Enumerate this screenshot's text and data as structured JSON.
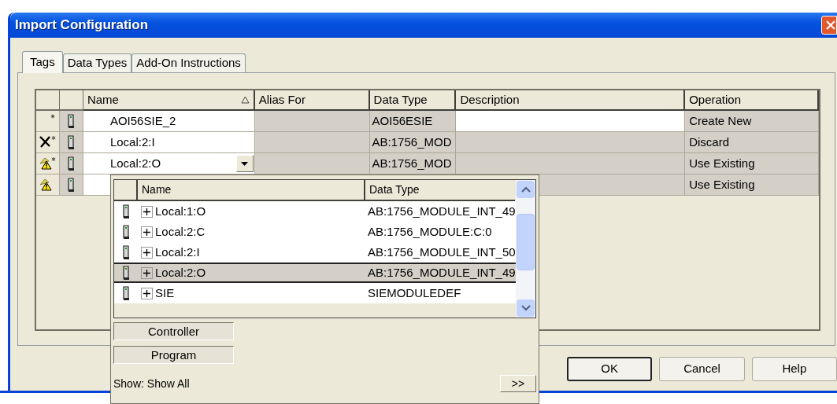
{
  "window": {
    "title": "Import Configuration"
  },
  "tabs": [
    {
      "label": "Tags",
      "selected": true
    },
    {
      "label": "Data Types",
      "selected": false
    },
    {
      "label": "Add-On Instructions",
      "selected": false
    }
  ],
  "grid": {
    "columns": [
      {
        "label": "Name",
        "sorted": true
      },
      {
        "label": "Alias For",
        "sorted": false
      },
      {
        "label": "Data Type",
        "sorted": false
      },
      {
        "label": "Description",
        "sorted": false
      },
      {
        "label": "Operation",
        "sorted": false
      }
    ],
    "rows": [
      {
        "kind": "new",
        "modified": true,
        "name": "AOI56SIE_2",
        "data_type": "AOI56ESIE",
        "description_editable": true,
        "editing": false,
        "operation": "Create New"
      },
      {
        "kind": "discard",
        "modified": true,
        "name": "Local:2:I",
        "data_type": "AB:1756_MOD",
        "description_editable": false,
        "editing": false,
        "operation": "Discard"
      },
      {
        "kind": "conflict",
        "modified": true,
        "name": "Local:2:O",
        "data_type": "AB:1756_MOD",
        "description_editable": false,
        "editing": true,
        "operation": "Use Existing"
      },
      {
        "kind": "conflict",
        "modified": false,
        "description_editable": false,
        "editing": false,
        "operation": "Use Existing"
      }
    ]
  },
  "tag_picker": {
    "columns": [
      "Name",
      "Data Type"
    ],
    "rows": [
      {
        "name": "Local:1:O",
        "data_type": "AB:1756_MODULE_INT_49",
        "selected": false
      },
      {
        "name": "Local:2:C",
        "data_type": "AB:1756_MODULE:C:0",
        "selected": false
      },
      {
        "name": "Local:2:I",
        "data_type": "AB:1756_MODULE_INT_50",
        "selected": false
      },
      {
        "name": "Local:2:O",
        "data_type": "AB:1756_MODULE_INT_49",
        "selected": true
      },
      {
        "name": "SIE",
        "data_type": "SIEMODULEDEF",
        "selected": false
      }
    ],
    "scope_buttons": [
      "Controller",
      "Program"
    ],
    "show_filter": "Show: Show All",
    "more_button": ">>"
  },
  "buttons": [
    {
      "label": "OK",
      "default": true
    },
    {
      "label": "Cancel",
      "default": false
    },
    {
      "label": "Help",
      "default": false
    }
  ]
}
